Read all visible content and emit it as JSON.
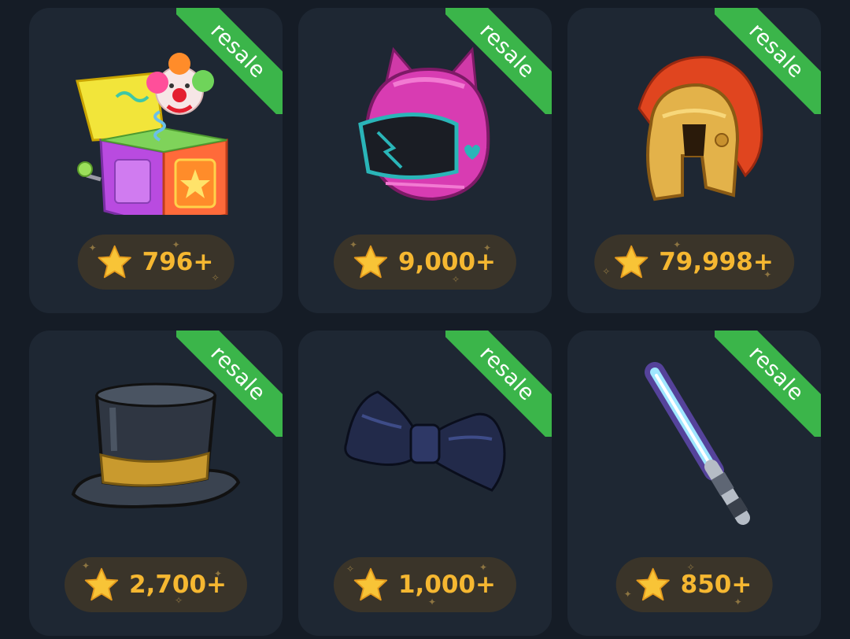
{
  "gifts": [
    {
      "name": "jack-in-the-box",
      "badge": "resale",
      "price": "796+"
    },
    {
      "name": "pink-cat-helmet",
      "badge": "resale",
      "price": "9,000+"
    },
    {
      "name": "spartan-helmet",
      "badge": "resale",
      "price": "79,998+"
    },
    {
      "name": "top-hat",
      "badge": "resale",
      "price": "2,700+"
    },
    {
      "name": "bow-tie",
      "badge": "resale",
      "price": "1,000+"
    },
    {
      "name": "light-sword",
      "badge": "resale",
      "price": "850+"
    }
  ],
  "colors": {
    "background": "#151c26",
    "card": "#1e2733",
    "ribbon": "#3bb54a",
    "price_pill": "#3a3429",
    "price_text": "#f5b731"
  },
  "icons": {
    "price": "star-icon"
  }
}
